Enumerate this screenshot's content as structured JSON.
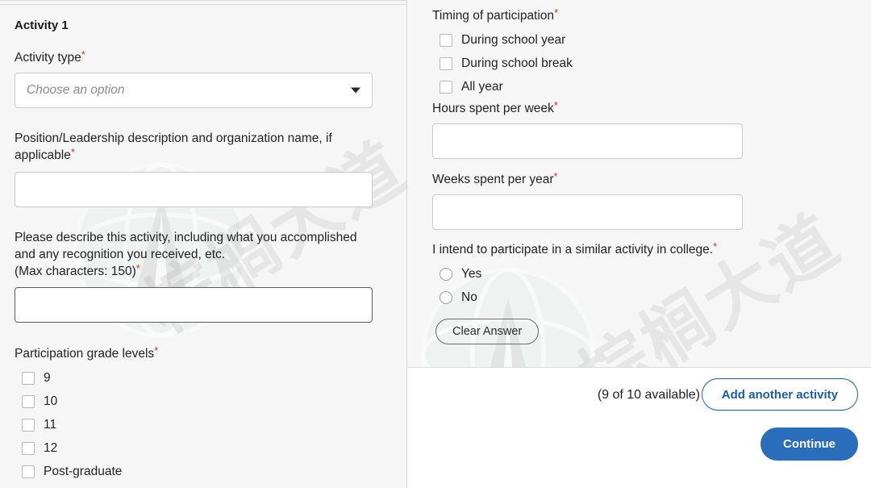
{
  "left_column": {
    "section_title": "Activity 1",
    "activity_type": {
      "label": "Activity type",
      "required_mark": "*",
      "placeholder": "Choose an option",
      "value": ""
    },
    "position_description": {
      "label": "Position/Leadership description and organization name, if applicable",
      "required_mark": "*",
      "value": ""
    },
    "describe_activity": {
      "label_line1": "Please describe this activity, including what you accomplished",
      "label_line2": "and any recognition you received, etc.",
      "label_line3": "(Max characters: 150)",
      "required_mark": "*",
      "value": ""
    },
    "grade_levels": {
      "label": "Participation grade levels",
      "required_mark": "*",
      "options": [
        "9",
        "10",
        "11",
        "12",
        "Post-graduate"
      ]
    }
  },
  "right_column": {
    "timing": {
      "label": "Timing of participation",
      "required_mark": "*",
      "options": [
        "During school year",
        "During school break",
        "All year"
      ]
    },
    "hours_per_week": {
      "label": "Hours spent per week",
      "required_mark": "*",
      "value": ""
    },
    "weeks_per_year": {
      "label": "Weeks spent per year",
      "required_mark": "*",
      "value": ""
    },
    "similar_activity": {
      "label": "I intend to participate in a similar activity in college.",
      "required_mark": "*",
      "options": [
        "Yes",
        "No"
      ],
      "clear_label": "Clear Answer"
    }
  },
  "footer": {
    "availability_text": "(9 of 10 available)",
    "add_activity_label": "Add another activity",
    "continue_label": "Continue"
  },
  "watermark": {
    "text": "棕榈大道"
  },
  "colors": {
    "accent_blue": "#2a6ebb",
    "outline_blue": "#1b5e9e",
    "required_red": "#c0392b",
    "page_bg": "#f6f6f6",
    "panel_bg": "#ffffff"
  }
}
